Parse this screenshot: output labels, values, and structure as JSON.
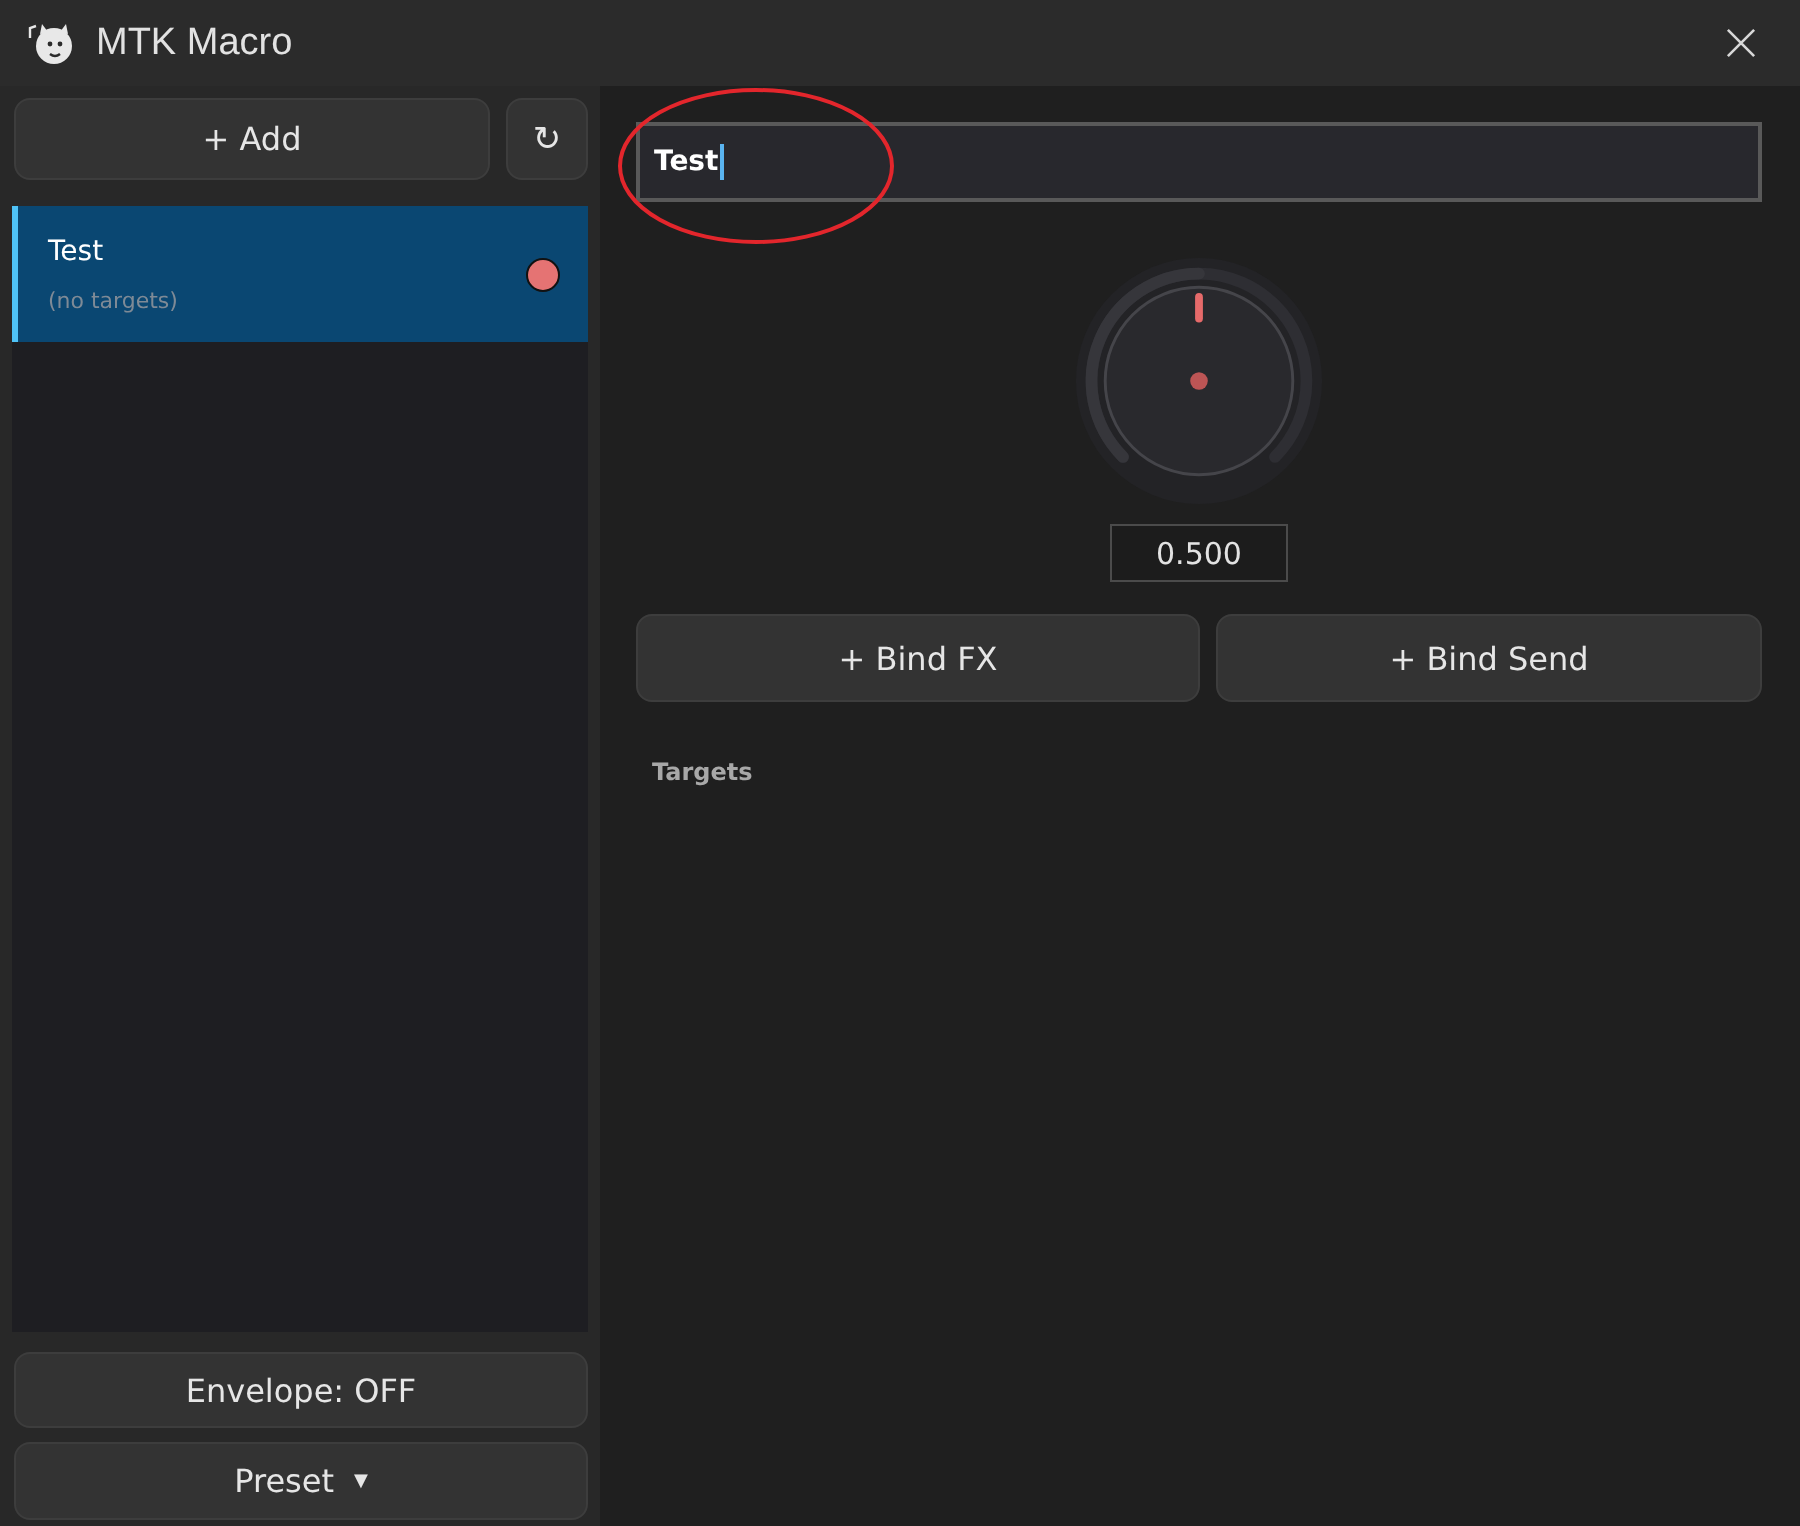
{
  "window": {
    "title": "MTK Macro"
  },
  "sidebar": {
    "add_button": "+ Add",
    "refresh_button": "↻",
    "macros": [
      {
        "name": "Test",
        "subtitle": "(no targets)",
        "selected": true,
        "color": "#e57373"
      }
    ],
    "envelope_button": "Envelope: OFF",
    "preset_button": {
      "label": "Preset",
      "caret": "▼"
    }
  },
  "editor": {
    "name_field": {
      "value": "Test"
    },
    "knob": {
      "level": 0.5,
      "reading": "0.500"
    },
    "buttons": [
      "+ Bind FX",
      "+ Bind Send"
    ],
    "targets_heading": "Targets"
  }
}
